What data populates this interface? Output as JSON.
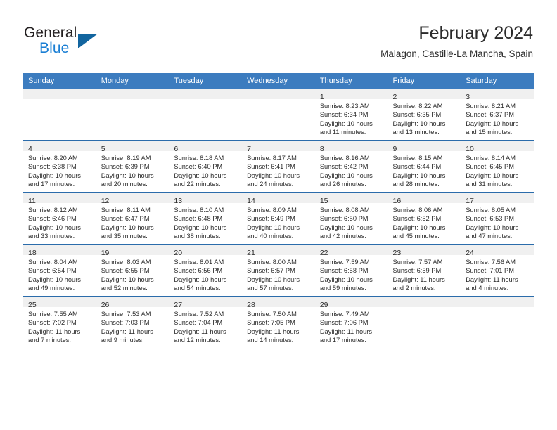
{
  "brand": {
    "name_top": "General",
    "name_bottom": "Blue",
    "triangle_color": "#12659f",
    "blue_color": "#1b7fd4"
  },
  "header": {
    "month_title": "February 2024",
    "location": "Malagon, Castille-La Mancha, Spain"
  },
  "theme": {
    "header_row_bg": "#3c7cbf",
    "daynum_band_bg": "#f0f0f0",
    "cell_border": "#2b6cab",
    "text": "#2b2b2b"
  },
  "columns": [
    "Sunday",
    "Monday",
    "Tuesday",
    "Wednesday",
    "Thursday",
    "Friday",
    "Saturday"
  ],
  "weeks": [
    [
      {
        "empty": true
      },
      {
        "empty": true
      },
      {
        "empty": true
      },
      {
        "empty": true
      },
      {
        "day": "1",
        "sunrise": "Sunrise: 8:23 AM",
        "sunset": "Sunset: 6:34 PM",
        "daylight_1": "Daylight: 10 hours",
        "daylight_2": "and 11 minutes."
      },
      {
        "day": "2",
        "sunrise": "Sunrise: 8:22 AM",
        "sunset": "Sunset: 6:35 PM",
        "daylight_1": "Daylight: 10 hours",
        "daylight_2": "and 13 minutes."
      },
      {
        "day": "3",
        "sunrise": "Sunrise: 8:21 AM",
        "sunset": "Sunset: 6:37 PM",
        "daylight_1": "Daylight: 10 hours",
        "daylight_2": "and 15 minutes."
      }
    ],
    [
      {
        "day": "4",
        "sunrise": "Sunrise: 8:20 AM",
        "sunset": "Sunset: 6:38 PM",
        "daylight_1": "Daylight: 10 hours",
        "daylight_2": "and 17 minutes."
      },
      {
        "day": "5",
        "sunrise": "Sunrise: 8:19 AM",
        "sunset": "Sunset: 6:39 PM",
        "daylight_1": "Daylight: 10 hours",
        "daylight_2": "and 20 minutes."
      },
      {
        "day": "6",
        "sunrise": "Sunrise: 8:18 AM",
        "sunset": "Sunset: 6:40 PM",
        "daylight_1": "Daylight: 10 hours",
        "daylight_2": "and 22 minutes."
      },
      {
        "day": "7",
        "sunrise": "Sunrise: 8:17 AM",
        "sunset": "Sunset: 6:41 PM",
        "daylight_1": "Daylight: 10 hours",
        "daylight_2": "and 24 minutes."
      },
      {
        "day": "8",
        "sunrise": "Sunrise: 8:16 AM",
        "sunset": "Sunset: 6:42 PM",
        "daylight_1": "Daylight: 10 hours",
        "daylight_2": "and 26 minutes."
      },
      {
        "day": "9",
        "sunrise": "Sunrise: 8:15 AM",
        "sunset": "Sunset: 6:44 PM",
        "daylight_1": "Daylight: 10 hours",
        "daylight_2": "and 28 minutes."
      },
      {
        "day": "10",
        "sunrise": "Sunrise: 8:14 AM",
        "sunset": "Sunset: 6:45 PM",
        "daylight_1": "Daylight: 10 hours",
        "daylight_2": "and 31 minutes."
      }
    ],
    [
      {
        "day": "11",
        "sunrise": "Sunrise: 8:12 AM",
        "sunset": "Sunset: 6:46 PM",
        "daylight_1": "Daylight: 10 hours",
        "daylight_2": "and 33 minutes."
      },
      {
        "day": "12",
        "sunrise": "Sunrise: 8:11 AM",
        "sunset": "Sunset: 6:47 PM",
        "daylight_1": "Daylight: 10 hours",
        "daylight_2": "and 35 minutes."
      },
      {
        "day": "13",
        "sunrise": "Sunrise: 8:10 AM",
        "sunset": "Sunset: 6:48 PM",
        "daylight_1": "Daylight: 10 hours",
        "daylight_2": "and 38 minutes."
      },
      {
        "day": "14",
        "sunrise": "Sunrise: 8:09 AM",
        "sunset": "Sunset: 6:49 PM",
        "daylight_1": "Daylight: 10 hours",
        "daylight_2": "and 40 minutes."
      },
      {
        "day": "15",
        "sunrise": "Sunrise: 8:08 AM",
        "sunset": "Sunset: 6:50 PM",
        "daylight_1": "Daylight: 10 hours",
        "daylight_2": "and 42 minutes."
      },
      {
        "day": "16",
        "sunrise": "Sunrise: 8:06 AM",
        "sunset": "Sunset: 6:52 PM",
        "daylight_1": "Daylight: 10 hours",
        "daylight_2": "and 45 minutes."
      },
      {
        "day": "17",
        "sunrise": "Sunrise: 8:05 AM",
        "sunset": "Sunset: 6:53 PM",
        "daylight_1": "Daylight: 10 hours",
        "daylight_2": "and 47 minutes."
      }
    ],
    [
      {
        "day": "18",
        "sunrise": "Sunrise: 8:04 AM",
        "sunset": "Sunset: 6:54 PM",
        "daylight_1": "Daylight: 10 hours",
        "daylight_2": "and 49 minutes."
      },
      {
        "day": "19",
        "sunrise": "Sunrise: 8:03 AM",
        "sunset": "Sunset: 6:55 PM",
        "daylight_1": "Daylight: 10 hours",
        "daylight_2": "and 52 minutes."
      },
      {
        "day": "20",
        "sunrise": "Sunrise: 8:01 AM",
        "sunset": "Sunset: 6:56 PM",
        "daylight_1": "Daylight: 10 hours",
        "daylight_2": "and 54 minutes."
      },
      {
        "day": "21",
        "sunrise": "Sunrise: 8:00 AM",
        "sunset": "Sunset: 6:57 PM",
        "daylight_1": "Daylight: 10 hours",
        "daylight_2": "and 57 minutes."
      },
      {
        "day": "22",
        "sunrise": "Sunrise: 7:59 AM",
        "sunset": "Sunset: 6:58 PM",
        "daylight_1": "Daylight: 10 hours",
        "daylight_2": "and 59 minutes."
      },
      {
        "day": "23",
        "sunrise": "Sunrise: 7:57 AM",
        "sunset": "Sunset: 6:59 PM",
        "daylight_1": "Daylight: 11 hours",
        "daylight_2": "and 2 minutes."
      },
      {
        "day": "24",
        "sunrise": "Sunrise: 7:56 AM",
        "sunset": "Sunset: 7:01 PM",
        "daylight_1": "Daylight: 11 hours",
        "daylight_2": "and 4 minutes."
      }
    ],
    [
      {
        "day": "25",
        "sunrise": "Sunrise: 7:55 AM",
        "sunset": "Sunset: 7:02 PM",
        "daylight_1": "Daylight: 11 hours",
        "daylight_2": "and 7 minutes."
      },
      {
        "day": "26",
        "sunrise": "Sunrise: 7:53 AM",
        "sunset": "Sunset: 7:03 PM",
        "daylight_1": "Daylight: 11 hours",
        "daylight_2": "and 9 minutes."
      },
      {
        "day": "27",
        "sunrise": "Sunrise: 7:52 AM",
        "sunset": "Sunset: 7:04 PM",
        "daylight_1": "Daylight: 11 hours",
        "daylight_2": "and 12 minutes."
      },
      {
        "day": "28",
        "sunrise": "Sunrise: 7:50 AM",
        "sunset": "Sunset: 7:05 PM",
        "daylight_1": "Daylight: 11 hours",
        "daylight_2": "and 14 minutes."
      },
      {
        "day": "29",
        "sunrise": "Sunrise: 7:49 AM",
        "sunset": "Sunset: 7:06 PM",
        "daylight_1": "Daylight: 11 hours",
        "daylight_2": "and 17 minutes."
      },
      {
        "empty": true
      },
      {
        "empty": true
      }
    ]
  ]
}
